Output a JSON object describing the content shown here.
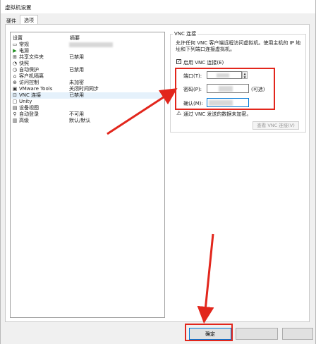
{
  "window": {
    "title": "虚拟机设置",
    "tabs": [
      {
        "label": "硬件"
      },
      {
        "label": "选项"
      }
    ]
  },
  "settings_list": {
    "headers": {
      "setting": "设置",
      "summary": "摘要"
    },
    "rows": [
      {
        "name": "常规",
        "summary": "",
        "icon": "general-icon",
        "glyph": "▭"
      },
      {
        "name": "电源",
        "summary": "",
        "icon": "power-play-icon",
        "glyph": "▶"
      },
      {
        "name": "共享文件夹",
        "summary": "已禁用",
        "icon": "shared-folder-icon",
        "glyph": "⊞"
      },
      {
        "name": "快照",
        "summary": "",
        "icon": "snapshot-icon",
        "glyph": "◔"
      },
      {
        "name": "自动保护",
        "summary": "已禁用",
        "icon": "autoprotect-clock-icon",
        "glyph": "◷"
      },
      {
        "name": "客户机隔离",
        "summary": "",
        "icon": "guest-isolation-lock-icon",
        "glyph": "⌂"
      },
      {
        "name": "访问控制",
        "summary": "未加密",
        "icon": "access-control-icon",
        "glyph": "⊕"
      },
      {
        "name": "VMware Tools",
        "summary": "关闭时间同步",
        "icon": "vmware-tools-icon",
        "glyph": "▣"
      },
      {
        "name": "VNC 连接",
        "summary": "已禁用",
        "icon": "vnc-connection-icon",
        "glyph": "⊡"
      },
      {
        "name": "Unity",
        "summary": "",
        "icon": "unity-icon",
        "glyph": "▢"
      },
      {
        "name": "设备视图",
        "summary": "",
        "icon": "device-view-icon",
        "glyph": "▤"
      },
      {
        "name": "自动登录",
        "summary": "不可用",
        "icon": "autologin-icon",
        "glyph": "⚲"
      },
      {
        "name": "高级",
        "summary": "默认/默认",
        "icon": "advanced-icon",
        "glyph": "▥"
      }
    ]
  },
  "vnc": {
    "legend": "VNC 连接",
    "description": "允许任何 VNC 客户端远程访问虚拟机。使用主机的 IP 地址和下列端口连接虚拟机。",
    "enable_label": "启用 VNC 连接(E)",
    "enable_mark": "✓",
    "port_label": "端口(T):",
    "password_label": "密码(P):",
    "optional_text": "(可选)",
    "confirm_label": "确认(M):",
    "warning_text": "通过 VNC 发送的数据未加密。",
    "warning_glyph": "⚠",
    "view_button": "查看 VNC 连接(V)"
  },
  "buttons": {
    "ok": "确定"
  },
  "colors": {
    "annotation_red": "#e2261c",
    "selection": "#e5f1fb"
  }
}
